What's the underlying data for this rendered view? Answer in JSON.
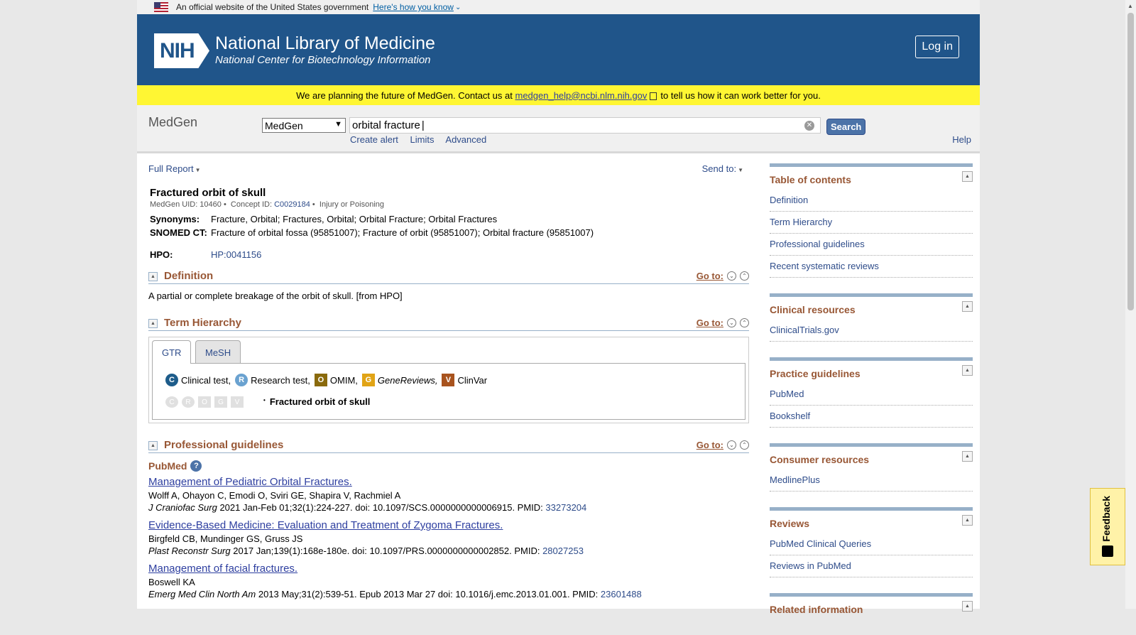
{
  "gov_banner": {
    "text": "An official website of the United States government",
    "link": "Here's how you know"
  },
  "header": {
    "title": "National Library of Medicine",
    "subtitle": "National Center for Biotechnology Information",
    "logo": "NIH",
    "login": "Log in"
  },
  "notice": {
    "before": "We are planning the future of MedGen. Contact us at",
    "email": "medgen_help@ncbi.nlm.nih.gov",
    "after": "to tell us how it can work better for you."
  },
  "search": {
    "db_name": "MedGen",
    "db_select": "MedGen",
    "query": "orbital fracture",
    "button": "Search",
    "links": [
      "Create alert",
      "Limits",
      "Advanced"
    ],
    "help": "Help"
  },
  "controls": {
    "full_report": "Full Report",
    "send_to": "Send to:"
  },
  "concept": {
    "title": "Fractured orbit of skull",
    "uid_label": "MedGen UID: 10460",
    "cid_label": "Concept ID:",
    "cid": "C0029184",
    "category": "Injury or Poisoning",
    "synonyms_label": "Synonyms:",
    "synonyms": "Fracture, Orbital; Fractures, Orbital; Orbital Fracture; Orbital Fractures",
    "snomed_label": "SNOMED CT:",
    "snomed": "Fracture of orbital fossa (95851007); Fracture of orbit (95851007); Orbital fracture (95851007)",
    "hpo_label": "HPO:",
    "hpo": "HP:0041156"
  },
  "sections": {
    "goto": "Go to:",
    "definition": {
      "title": "Definition",
      "text": "A partial or complete breakage of the orbit of skull. [from HPO]"
    },
    "hierarchy": {
      "title": "Term Hierarchy",
      "tabs": [
        "GTR",
        "MeSH"
      ],
      "legend": [
        {
          "badge": "C",
          "label": "Clinical test,"
        },
        {
          "badge": "R",
          "label": "Research test,"
        },
        {
          "badge": "O",
          "label": "OMIM,"
        },
        {
          "badge": "G",
          "label": "GeneReviews,"
        },
        {
          "badge": "V",
          "label": "ClinVar"
        }
      ],
      "term": "Fractured orbit of skull"
    },
    "guidelines": {
      "title": "Professional guidelines",
      "source": "PubMed",
      "citations": [
        {
          "title": "Management of Pediatric Orbital Fractures.",
          "authors": "Wolff A, Ohayon C, Emodi O, Sviri GE, Shapira V, Rachmiel A",
          "journal": "J Craniofac Surg",
          "details": "2021 Jan-Feb 01;32(1):224-227. doi: 10.1097/SCS.0000000000006915. PMID:",
          "pmid": "33273204"
        },
        {
          "title": "Evidence-Based Medicine: Evaluation and Treatment of Zygoma Fractures.",
          "authors": "Birgfeld CB, Mundinger GS, Gruss JS",
          "journal": "Plast Reconstr Surg",
          "details": "2017 Jan;139(1):168e-180e. doi: 10.1097/PRS.0000000000002852. PMID:",
          "pmid": "28027253"
        },
        {
          "title": "Management of facial fractures.",
          "authors": "Boswell KA",
          "journal": "Emerg Med Clin North Am",
          "details": "2013 May;31(2):539-51. Epub 2013 Mar 27 doi: 10.1016/j.emc.2013.01.001. PMID:",
          "pmid": "23601488"
        }
      ]
    }
  },
  "sidebar": {
    "toc": {
      "title": "Table of contents",
      "items": [
        "Definition",
        "Term Hierarchy",
        "Professional guidelines",
        "Recent systematic reviews"
      ]
    },
    "clinical": {
      "title": "Clinical resources",
      "items": [
        "ClinicalTrials.gov"
      ]
    },
    "practice": {
      "title": "Practice guidelines",
      "items": [
        "PubMed",
        "Bookshelf"
      ]
    },
    "consumer": {
      "title": "Consumer resources",
      "items": [
        "MedlinePlus"
      ]
    },
    "reviews": {
      "title": "Reviews",
      "items": [
        "PubMed Clinical Queries",
        "Reviews in PubMed"
      ]
    },
    "related": {
      "title": "Related information"
    }
  },
  "feedback": "Feedback"
}
